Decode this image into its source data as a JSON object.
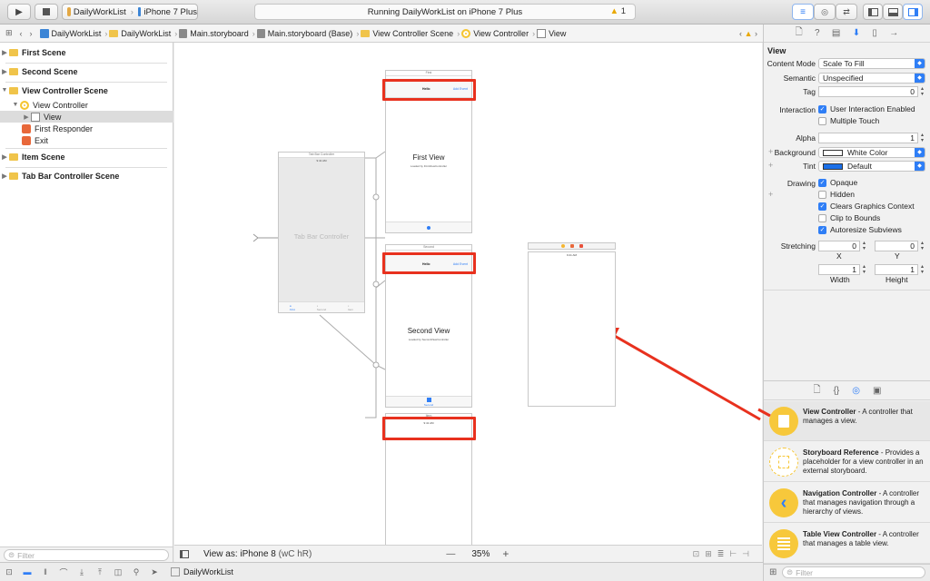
{
  "toolbar": {
    "scheme_target": "DailyWorkList",
    "scheme_device": "iPhone 7 Plus",
    "status_text": "Running DailyWorkList on iPhone 7 Plus",
    "warning_count": "1"
  },
  "jumpbar": {
    "crumbs": [
      "DailyWorkList",
      "DailyWorkList",
      "Main.storyboard",
      "Main.storyboard (Base)",
      "View Controller Scene",
      "View Controller",
      "View"
    ]
  },
  "navigator": {
    "items": [
      {
        "label": "First Scene"
      },
      {
        "label": "Second Scene"
      },
      {
        "label": "View Controller Scene"
      },
      {
        "label": "View Controller"
      },
      {
        "label": "View"
      },
      {
        "label": "First Responder"
      },
      {
        "label": "Exit"
      },
      {
        "label": "Item Scene"
      },
      {
        "label": "Tab Bar Controller Scene"
      }
    ],
    "filter_placeholder": "Filter"
  },
  "canvas": {
    "tab_bar_title": "Tab Bar Controller",
    "tab_bar_label": "Tab Bar Controller",
    "time": "9:41 AM",
    "first_title": "First",
    "first_nav_title": "Hello",
    "first_nav_button": "Add Event",
    "first_view_label": "First View",
    "first_view_sub": "Loaded by FirstViewController",
    "second_title": "Second",
    "second_nav_title": "Hello",
    "second_nav_button": "Add Event",
    "second_view_label": "Second View",
    "second_view_sub": "Loaded by SecondViewController",
    "second_tab": "Second",
    "item_title": "Item",
    "tab_first": "First",
    "tab_second": "Second",
    "tab_item": "Item"
  },
  "canvas_bottom": {
    "view_as": "View as: iPhone 8",
    "size_class": "(wC hR)",
    "minus": "—",
    "zoom": "35%",
    "plus": "+"
  },
  "debugbar": {
    "target": "DailyWorkList"
  },
  "inspector": {
    "section": "View",
    "content_mode_label": "Content Mode",
    "content_mode": "Scale To Fill",
    "semantic_label": "Semantic",
    "semantic": "Unspecified",
    "tag_label": "Tag",
    "tag": "0",
    "interaction_label": "Interaction",
    "user_interaction": "User Interaction Enabled",
    "multiple_touch": "Multiple Touch",
    "alpha_label": "Alpha",
    "alpha": "1",
    "background_label": "Background",
    "background": "White Color",
    "tint_label": "Tint",
    "tint": "Default",
    "drawing_label": "Drawing",
    "opaque": "Opaque",
    "hidden": "Hidden",
    "clears": "Clears Graphics Context",
    "clip": "Clip to Bounds",
    "autoresize": "Autoresize Subviews",
    "stretching_label": "Stretching",
    "sx": "0",
    "sy": "0",
    "sw": "1",
    "sh": "1",
    "x_label": "X",
    "y_label": "Y",
    "w_label": "Width",
    "h_label": "Height",
    "tint_color": "#1a6fe8"
  },
  "library": {
    "items": [
      {
        "title": "View Controller",
        "desc": " - A controller that manages a view."
      },
      {
        "title": "Storyboard Reference",
        "desc": " - Provides a placeholder for a view controller in an external storyboard."
      },
      {
        "title": "Navigation Controller",
        "desc": " - A controller that manages navigation through a hierarchy of views."
      },
      {
        "title": "Table View Controller",
        "desc": " - A controller that manages a table view."
      }
    ],
    "filter_placeholder": "Filter"
  },
  "colors": {
    "annotation_red": "#e8311e",
    "accent_blue": "#2f7ef6",
    "icon_yellow": "#f7c83b"
  }
}
